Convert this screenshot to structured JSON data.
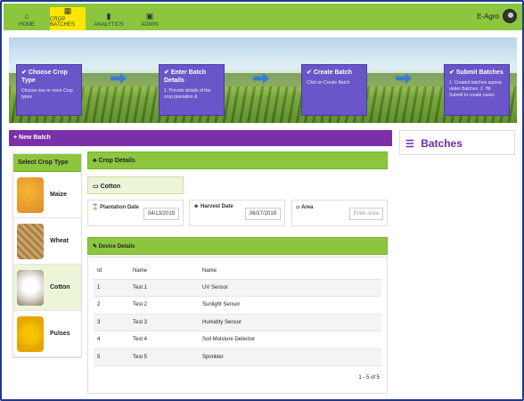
{
  "nav": {
    "items": [
      {
        "label": "HOME",
        "icon": "home-icon"
      },
      {
        "label": "CROP BATCHES",
        "icon": "grid-icon"
      },
      {
        "label": "ANALYTICS",
        "icon": "bar-chart-icon"
      },
      {
        "label": "ADMIN",
        "icon": "lock-icon"
      }
    ],
    "brand": "E-Agro",
    "accent": "#8cc63f",
    "active_color": "#ffe600"
  },
  "steps": [
    {
      "title": "Choose Crop Type",
      "desc": "Choose one or more Crop types"
    },
    {
      "title": "Enter Batch Details",
      "desc": "1. Provide details of the crop plantation &"
    },
    {
      "title": "Create Batch",
      "desc": "Click on Create Batch"
    },
    {
      "title": "Submit Batches",
      "desc": "1. Created batches appear under Batches. 2. Hit Submit to create cases"
    }
  ],
  "new_batch": "+ New Batch",
  "batches_title": "Batches",
  "crop_types": {
    "header": "Select Crop Type",
    "items": [
      "Maize",
      "Wheat",
      "Cotton",
      "Pulses"
    ]
  },
  "crop_details": {
    "header": "Crop Details",
    "selected_crop": "Cotton",
    "plantation_label": "Plantation Date",
    "plantation_value": "04/13/2019",
    "harvest_label": "Harvest Date",
    "harvest_value": "06/27/2019",
    "area_label": "Area",
    "area_placeholder": "Enter Area"
  },
  "device_details": {
    "header": "Device Details",
    "columns": [
      "Id",
      "Name",
      "Name"
    ],
    "rows": [
      [
        "1",
        "Test 1",
        "UV Sensor"
      ],
      [
        "2",
        "Test 2",
        "Sunlight Sensor"
      ],
      [
        "3",
        "Test 3",
        "Humidity Sensor"
      ],
      [
        "4",
        "Test 4",
        "Soil Moisture Detector"
      ],
      [
        "5",
        "Test 5",
        "Sprinkler"
      ]
    ],
    "pager": "1 - 5 of 5"
  }
}
